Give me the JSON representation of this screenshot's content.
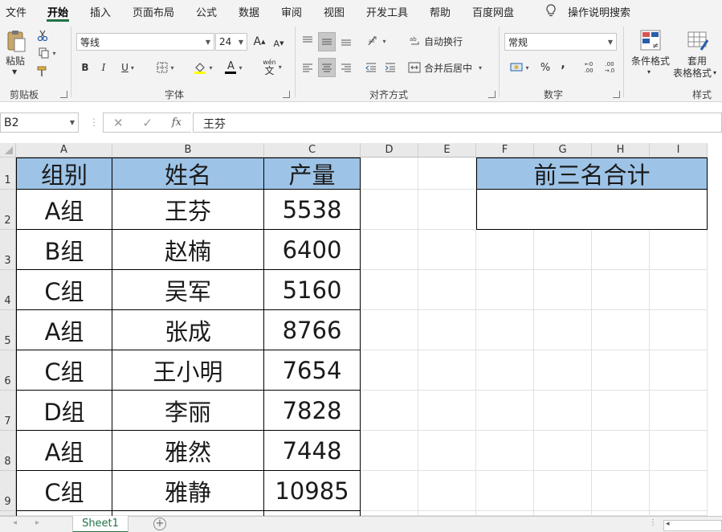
{
  "menu": {
    "items": [
      "文件",
      "开始",
      "插入",
      "页面布局",
      "公式",
      "数据",
      "审阅",
      "视图",
      "开发工具",
      "帮助",
      "百度网盘"
    ],
    "active": "开始",
    "search": "操作说明搜索"
  },
  "ribbon": {
    "clipboard": {
      "paste_label": "粘贴",
      "group_label": "剪贴板"
    },
    "font": {
      "name": "等线",
      "size": "24",
      "bold": "B",
      "italic": "I",
      "underline": "U",
      "font_color_glyph": "A",
      "phonetic_glyph": "wén",
      "phonetic_char": "文",
      "grow_glyph": "A",
      "shrink_glyph": "A",
      "group_label": "字体"
    },
    "alignment": {
      "wrap_text": "自动换行",
      "merge_center": "合并后居中",
      "group_label": "对齐方式"
    },
    "number": {
      "format": "常规",
      "percent": "%",
      "comma": ",",
      "inc_decimal_top": "←0",
      "inc_decimal_bottom": ".00",
      "dec_decimal_top": ".00",
      "dec_decimal_bottom": "→.0",
      "group_label": "数字"
    },
    "styles": {
      "conditional_format": "条件格式",
      "table_format_line1": "套用",
      "table_format_line2": "表格格式",
      "group_label": "样式"
    }
  },
  "formula_bar": {
    "name_box": "B2",
    "fx_label": "fx",
    "value": "王芬"
  },
  "grid": {
    "columns": [
      "A",
      "B",
      "C",
      "D",
      "E",
      "F",
      "G",
      "H",
      "I"
    ],
    "rows": [
      "1",
      "2",
      "3",
      "4",
      "5",
      "6",
      "7",
      "8",
      "9"
    ],
    "table_headers": [
      "组别",
      "姓名",
      "产量"
    ],
    "table_rows": [
      [
        "A组",
        "王芬",
        "5538"
      ],
      [
        "B组",
        "赵楠",
        "6400"
      ],
      [
        "C组",
        "吴军",
        "5160"
      ],
      [
        "A组",
        "张成",
        "8766"
      ],
      [
        "C组",
        "王小明",
        "7654"
      ],
      [
        "D组",
        "李丽",
        "7828"
      ],
      [
        "A组",
        "雅然",
        "7448"
      ],
      [
        "C组",
        "雅静",
        "10985"
      ]
    ],
    "summary_header": "前三名合计",
    "summary_value": ""
  },
  "sheets": {
    "active": "Sheet1"
  },
  "colors": {
    "header_fill": "#9dc3e6",
    "accent": "#217346"
  }
}
